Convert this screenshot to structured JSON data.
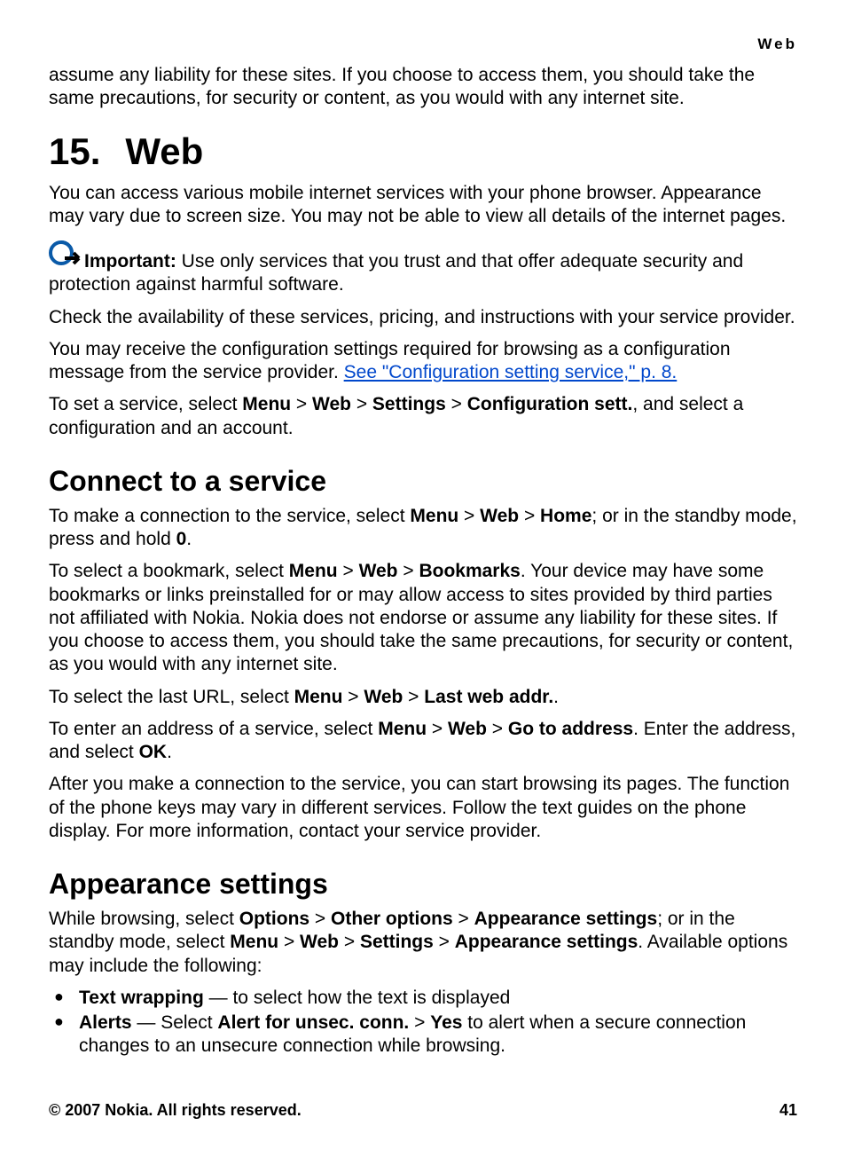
{
  "header": {
    "section_label": "Web"
  },
  "intro_continuation": "assume any liability for these sites. If you choose to access them, you should take the same precautions, for security or content, as you would with any internet site.",
  "chapter": {
    "number": "15.",
    "title": "Web"
  },
  "para1": "You can access various mobile internet services with your phone browser. Appearance may vary due to screen size. You may not be able to view all details of the internet pages.",
  "important": {
    "label": "Important:",
    "text": "  Use only services that you trust and that offer adequate security and protection against harmful software."
  },
  "para2": "Check the availability of these services, pricing, and instructions with your service provider.",
  "para3_a": "You may receive the configuration settings required for browsing as a configuration message from the service provider. ",
  "para3_link": "See \"Configuration setting service,\" p. 8.",
  "para4_a": "To set a service, select ",
  "para4_b": ", and select a configuration and an account.",
  "menu": "Menu",
  "web": "Web",
  "settings": "Settings",
  "config_sett": "Configuration sett.",
  "gt": " > ",
  "connect": {
    "title": "Connect to a service",
    "p1_a": "To make a connection to the service, select ",
    "home": "Home",
    "p1_b": "; or in the standby mode, press and hold ",
    "zero": "0",
    "p1_c": ".",
    "p2_a": "To select a bookmark, select ",
    "bookmarks": "Bookmarks",
    "p2_b": ". Your device may have some bookmarks or links preinstalled for or may allow access to sites provided by third parties not affiliated with Nokia. Nokia does not endorse or assume any liability for these sites. If you choose to access them, you should take the same precautions, for security or content, as you would with any internet site.",
    "p3_a": "To select the last URL, select ",
    "last_web": "Last web addr.",
    "p3_b": ".",
    "p4_a": "To enter an address of a service, select ",
    "goto": "Go to address",
    "p4_b": ". Enter the address, and select ",
    "ok": "OK",
    "p4_c": ".",
    "p5": "After you make a connection to the service, you can start browsing its pages. The function of the phone keys may vary in different services. Follow the text guides on the phone display. For more information, contact your service provider."
  },
  "appearance": {
    "title": "Appearance settings",
    "p1_a": "While browsing, select ",
    "options": "Options",
    "other_options": "Other options",
    "appearance_settings": "Appearance settings",
    "p1_b": "; or in the standby mode, select ",
    "p1_c": ". Available options may include the following:",
    "li1_bold": "Text wrapping",
    "li1_text": "  — to select how the text is displayed",
    "li2_bold1": "Alerts",
    "li2_text1": "  — Select ",
    "li2_bold2": "Alert for unsec. conn.",
    "li2_bold3": "Yes",
    "li2_text2": " to alert when a secure connection changes to an unsecure connection while browsing."
  },
  "footer": {
    "copyright": "© 2007 Nokia. All rights reserved.",
    "page": "41"
  }
}
